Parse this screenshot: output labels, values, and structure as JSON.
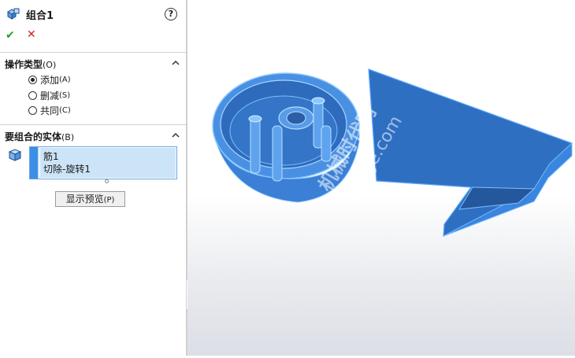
{
  "feature": {
    "title": "组合1"
  },
  "help": {
    "label": "?"
  },
  "actions": {
    "ok": "✔",
    "cancel": "✕"
  },
  "operation_type": {
    "title": "操作类型",
    "accel": "(O)",
    "options": [
      {
        "label": "添加",
        "accel": "(A)",
        "selected": true
      },
      {
        "label": "删减",
        "accel": "(S)",
        "selected": false
      },
      {
        "label": "共同",
        "accel": "(C)",
        "selected": false
      }
    ]
  },
  "bodies": {
    "title": "要组合的实体",
    "accel": "(B)",
    "items": [
      "筋1",
      "切除-旋转1"
    ]
  },
  "preview_button": {
    "label": "显示预览",
    "accel": "(P)"
  },
  "watermark": {
    "line1": "机械时代网",
    "line2": "jixiage.com"
  },
  "colors": {
    "selection": "#cce4f7",
    "accent": "#3b8fe6",
    "model": "#3f7fd8",
    "ok": "#2a9a2a",
    "cancel": "#d02020"
  }
}
